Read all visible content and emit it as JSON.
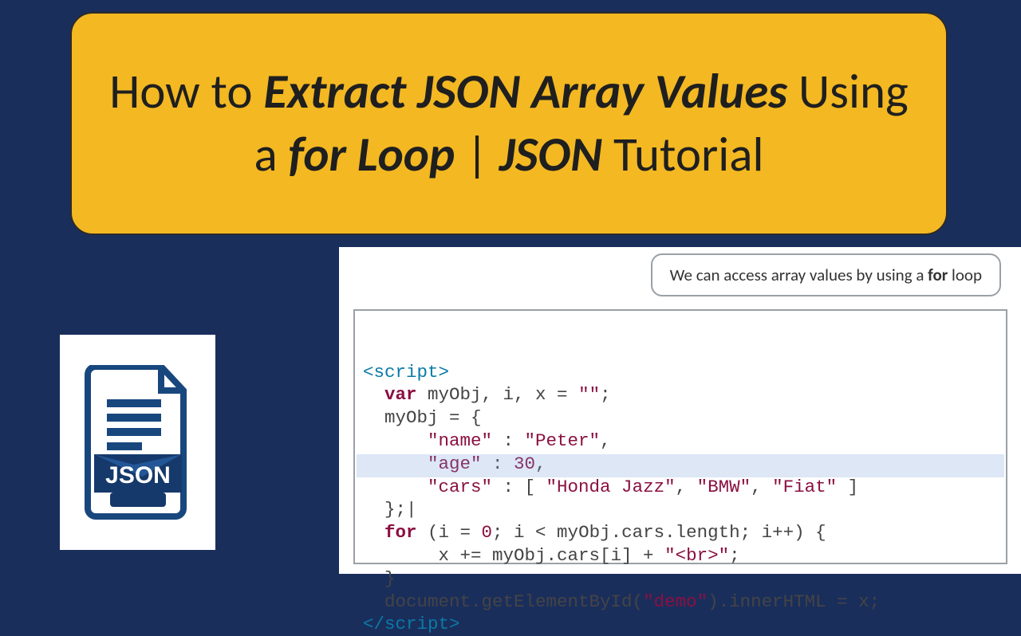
{
  "title": {
    "t1": "How to ",
    "t2": "Extract JSON Array Values",
    "t3": " Using a ",
    "t4": "for Loop",
    "t5": " | ",
    "t6": "JSON",
    "t7": " Tutorial"
  },
  "icon": {
    "label": "JSON"
  },
  "callout": {
    "pre": "We can access array values by using a ",
    "bold": "for",
    "post": " loop"
  },
  "code": {
    "l1a": "<script>",
    "l2a": "  var",
    "l2b": " myObj, i, x = ",
    "l2c": "\"\"",
    "l2d": ";",
    "l3": "  myObj = {",
    "l4a": "      \"name\"",
    "l4b": " : ",
    "l4c": "\"Peter\"",
    "l4d": ",",
    "l5a": "      \"age\"",
    "l5b": " : ",
    "l5c": "30",
    "l5d": ",",
    "l6a": "      \"cars\"",
    "l6b": " : [ ",
    "l6c": "\"Honda Jazz\"",
    "l6d": ", ",
    "l6e": "\"BMW\"",
    "l6f": ", ",
    "l6g": "\"Fiat\"",
    "l6h": " ]",
    "l7": "  };|",
    "l8a": "  for",
    "l8b": " (i = ",
    "l8c": "0",
    "l8d": "; i < myObj.cars.length; i++) {",
    "l9a": "       x += myObj.cars[i] + ",
    "l9b": "\"<br>\"",
    "l9c": ";",
    "l10": "  }",
    "l11a": "  document.getElementById(",
    "l11b": "\"demo\"",
    "l11c": ").innerHTML = x;",
    "l12": "</script>"
  }
}
